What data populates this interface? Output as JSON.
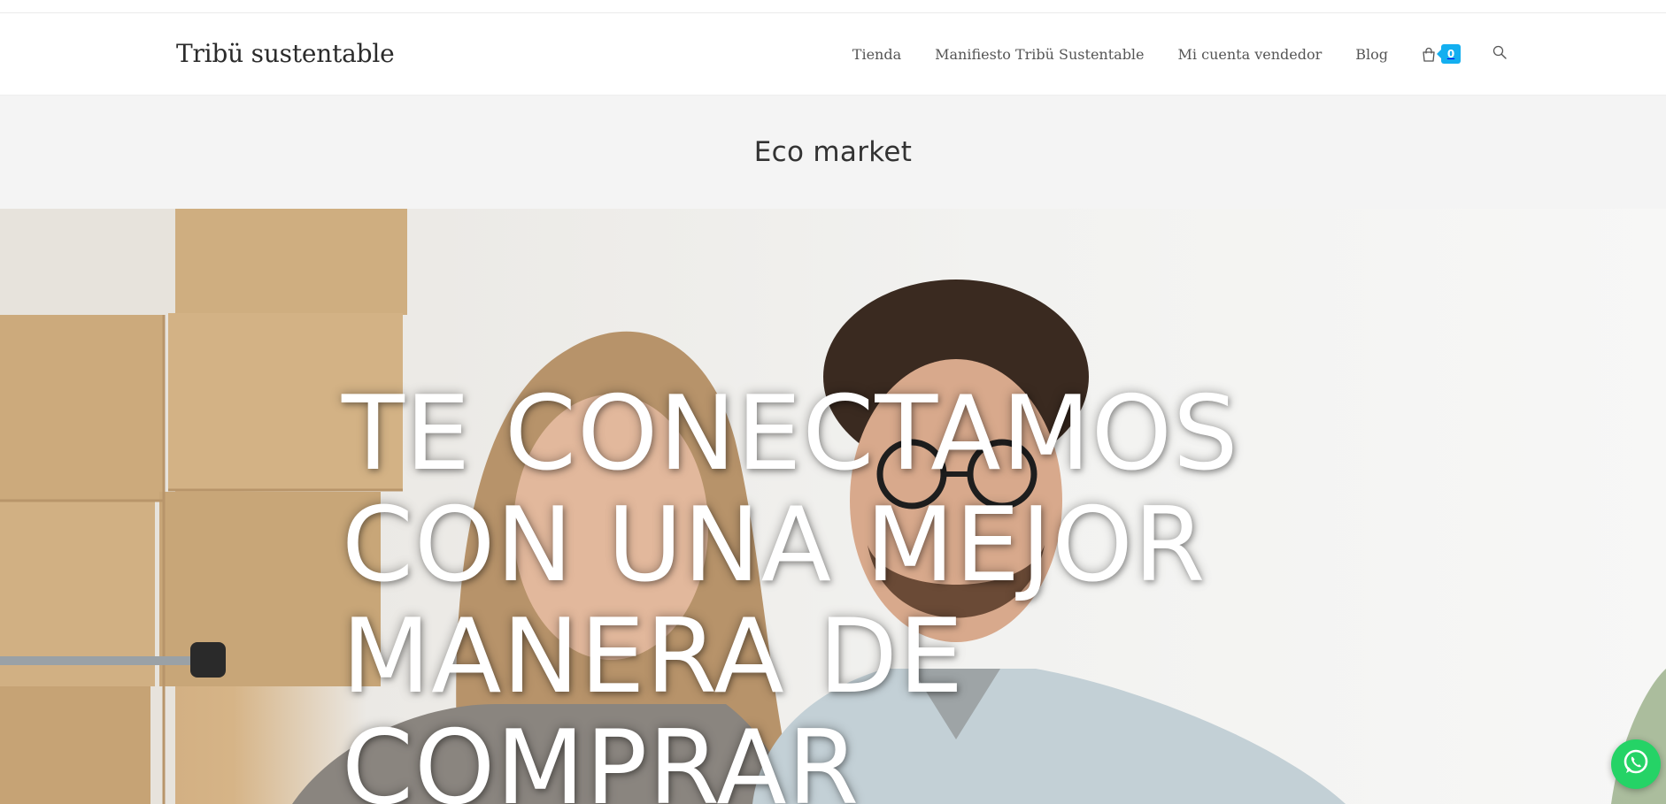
{
  "site": {
    "logo": "Tribü sustentable"
  },
  "nav": {
    "items": [
      {
        "label": "Tienda"
      },
      {
        "label": "Manifiesto Tribü Sustentable"
      },
      {
        "label": "Mi cuenta vendedor"
      },
      {
        "label": "Blog"
      }
    ],
    "cart_count": "0",
    "cart_icon": "shopping-bag-icon",
    "search_icon": "search-icon"
  },
  "page_header": {
    "title": "Eco market"
  },
  "hero": {
    "headline": "TE CONECTAMOS CON UNA MEJOR MANERA DE COMPRAR"
  },
  "floating": {
    "whatsapp_icon": "whatsapp-icon"
  },
  "colors": {
    "accent": "#13aff0",
    "whatsapp": "#25d366",
    "page_header_bg": "#f4f4f4"
  }
}
